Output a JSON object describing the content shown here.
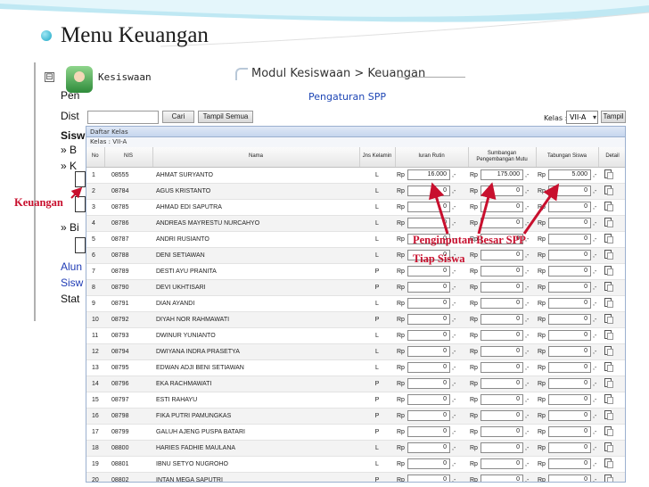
{
  "slide": {
    "title": "Menu Keuangan"
  },
  "left_panel": {
    "tree_toggle": "⊟",
    "rows": [
      "Pen",
      "Dist",
      "Sisw",
      "» B",
      "» K",
      "",
      "» Bi",
      "",
      "Alun",
      "Sisw",
      "Stat"
    ],
    "side_label": "Keuangan"
  },
  "header": {
    "app_title": "Kesiswaan",
    "breadcrumb": "Modul Kesiswaan > Keuangan",
    "page_subtitle": "Pengaturan SPP"
  },
  "toolbar": {
    "search_placeholder": "",
    "search_button": "Cari",
    "show_all_button": "Tampil Semua",
    "kelas_label": "Kelas :",
    "kelas_value": "VII-A",
    "show_button": "Tampil"
  },
  "grid": {
    "title": "Daftar Kelas",
    "subtitle": "Kelas : VII-A",
    "columns": [
      "No",
      "NIS",
      "Nama",
      "Jns Kelamin",
      "Iuran Rutin",
      "Sumbangan Pengembangan Mutu",
      "Tabungan Siswa",
      "Detail"
    ],
    "currency": "Rp",
    "suffix": ",-",
    "rows": [
      {
        "no": "1",
        "nis": "08555",
        "nama": "AHMAT SURYANTO",
        "jk": "L",
        "iuran": "16.000",
        "sumbangan": "175.000",
        "tabungan": "5.000"
      },
      {
        "no": "2",
        "nis": "08784",
        "nama": "AGUS KRISTANTO",
        "jk": "L",
        "iuran": "0",
        "sumbangan": "0",
        "tabungan": "0"
      },
      {
        "no": "3",
        "nis": "08785",
        "nama": "AHMAD EDI SAPUTRA",
        "jk": "L",
        "iuran": "0",
        "sumbangan": "0",
        "tabungan": "0"
      },
      {
        "no": "4",
        "nis": "08786",
        "nama": "ANDREAS MAYRESTU NURCAHYO",
        "jk": "L",
        "iuran": "0",
        "sumbangan": "0",
        "tabungan": "0"
      },
      {
        "no": "5",
        "nis": "08787",
        "nama": "ANDRI RUSIANTO",
        "jk": "L",
        "iuran": "0",
        "sumbangan": "0",
        "tabungan": "0"
      },
      {
        "no": "6",
        "nis": "08788",
        "nama": "DENI SETIAWAN",
        "jk": "L",
        "iuran": "0",
        "sumbangan": "0",
        "tabungan": "0"
      },
      {
        "no": "7",
        "nis": "08789",
        "nama": "DESTI AYU PRANITA",
        "jk": "P",
        "iuran": "0",
        "sumbangan": "0",
        "tabungan": "0"
      },
      {
        "no": "8",
        "nis": "08790",
        "nama": "DEVI UKHTISARI",
        "jk": "P",
        "iuran": "0",
        "sumbangan": "0",
        "tabungan": "0"
      },
      {
        "no": "9",
        "nis": "08791",
        "nama": "DIAN AYANDI",
        "jk": "L",
        "iuran": "0",
        "sumbangan": "0",
        "tabungan": "0"
      },
      {
        "no": "10",
        "nis": "08792",
        "nama": "DIYAH NOR RAHMAWATI",
        "jk": "P",
        "iuran": "0",
        "sumbangan": "0",
        "tabungan": "0"
      },
      {
        "no": "11",
        "nis": "08793",
        "nama": "DWINUR YUNIANTO",
        "jk": "L",
        "iuran": "0",
        "sumbangan": "0",
        "tabungan": "0"
      },
      {
        "no": "12",
        "nis": "08794",
        "nama": "DWIYANA INDRA PRASETYA",
        "jk": "L",
        "iuran": "0",
        "sumbangan": "0",
        "tabungan": "0"
      },
      {
        "no": "13",
        "nis": "08795",
        "nama": "EDWAN ADJI BENI SETIAWAN",
        "jk": "L",
        "iuran": "0",
        "sumbangan": "0",
        "tabungan": "0"
      },
      {
        "no": "14",
        "nis": "08796",
        "nama": "EKA RACHMAWATI",
        "jk": "P",
        "iuran": "0",
        "sumbangan": "0",
        "tabungan": "0"
      },
      {
        "no": "15",
        "nis": "08797",
        "nama": "ESTI RAHAYU",
        "jk": "P",
        "iuran": "0",
        "sumbangan": "0",
        "tabungan": "0"
      },
      {
        "no": "16",
        "nis": "08798",
        "nama": "FIKA PUTRI PAMUNGKAS",
        "jk": "P",
        "iuran": "0",
        "sumbangan": "0",
        "tabungan": "0"
      },
      {
        "no": "17",
        "nis": "08799",
        "nama": "GALUH AJENG PUSPA BATARI",
        "jk": "P",
        "iuran": "0",
        "sumbangan": "0",
        "tabungan": "0"
      },
      {
        "no": "18",
        "nis": "08800",
        "nama": "HARIES FADHIE MAULANA",
        "jk": "L",
        "iuran": "0",
        "sumbangan": "0",
        "tabungan": "0"
      },
      {
        "no": "19",
        "nis": "08801",
        "nama": "IBNU SETYO NUGROHO",
        "jk": "L",
        "iuran": "0",
        "sumbangan": "0",
        "tabungan": "0"
      },
      {
        "no": "20",
        "nis": "08802",
        "nama": "INTAN MEGA SAPUTRI",
        "jk": "P",
        "iuran": "0",
        "sumbangan": "0",
        "tabungan": "0"
      }
    ]
  },
  "annotation": {
    "line1": "Penginputan Besar SPP",
    "line2": "Tiap Siswa",
    "color": "#c8102e"
  }
}
